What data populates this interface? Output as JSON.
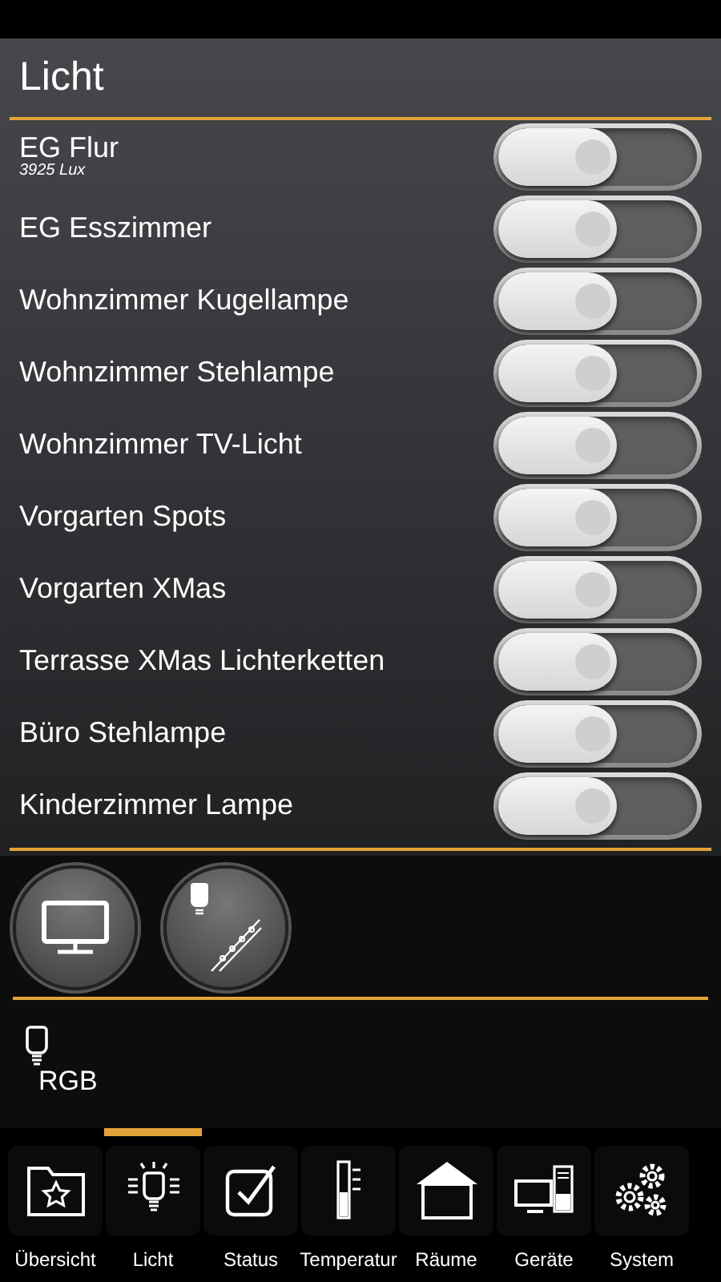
{
  "title": "Licht",
  "lights": [
    {
      "name": "EG Flur",
      "sub": "3925 Lux",
      "on": false
    },
    {
      "name": "EG Esszimmer",
      "on": false
    },
    {
      "name": "Wohnzimmer Kugellampe",
      "on": false
    },
    {
      "name": "Wohnzimmer Stehlampe",
      "on": false
    },
    {
      "name": "Wohnzimmer TV-Licht",
      "on": false
    },
    {
      "name": "Vorgarten Spots",
      "on": false
    },
    {
      "name": "Vorgarten XMas",
      "on": false
    },
    {
      "name": "Terrasse XMas Lichterketten",
      "on": false
    },
    {
      "name": "Büro Stehlampe",
      "on": false
    },
    {
      "name": "Kinderzimmer Lampe",
      "on": false
    }
  ],
  "scene_buttons": [
    {
      "kind": "tv"
    },
    {
      "kind": "strip"
    }
  ],
  "rgb": {
    "label": "RGB"
  },
  "nav": [
    {
      "label": "Übersicht",
      "kind": "folder",
      "selected": false
    },
    {
      "label": "Licht",
      "kind": "bulb",
      "selected": true
    },
    {
      "label": "Status",
      "kind": "check",
      "selected": false
    },
    {
      "label": "Temperatur",
      "kind": "thermo",
      "selected": false
    },
    {
      "label": "Räume",
      "kind": "house",
      "selected": false
    },
    {
      "label": "Geräte",
      "kind": "devices",
      "selected": false
    },
    {
      "label": "System",
      "kind": "gears",
      "selected": false
    }
  ]
}
